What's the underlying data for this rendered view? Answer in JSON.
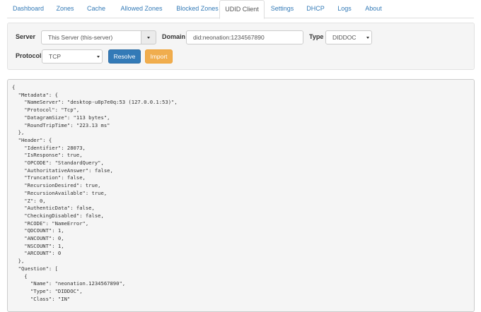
{
  "tabs": [
    {
      "label": "Dashboard"
    },
    {
      "label": "Zones"
    },
    {
      "label": "Cache"
    },
    {
      "label": "Allowed Zones"
    },
    {
      "label": "Blocked Zones"
    },
    {
      "label": "UDID Client"
    },
    {
      "label": "Settings"
    },
    {
      "label": "DHCP"
    },
    {
      "label": "Logs"
    },
    {
      "label": "About"
    }
  ],
  "active_tab": "UDID Client",
  "form": {
    "server_label": "Server",
    "server_value": "This Server (this-server)",
    "domain_label": "Domain",
    "domain_value": "did:neonation:1234567890",
    "type_label": "Type",
    "type_value": "DIDDOC",
    "protocol_label": "Protocol",
    "protocol_value": "TCP",
    "resolve_label": "Resolve",
    "import_label": "Import"
  },
  "colors": {
    "link": "#337ab7",
    "primary": "#337ab7",
    "warning": "#f0ad4e",
    "panel_bg": "#f5f5f5"
  },
  "output_text": "{\n  \"Metadata\": {\n    \"NameServer\": \"desktop-u8p7e0q:53 (127.0.0.1:53)\",\n    \"Protocol\": \"Tcp\",\n    \"DatagramSize\": \"113 bytes\",\n    \"RoundTripTime\": \"223.13 ms\"\n  },\n  \"Header\": {\n    \"Identifier\": 28073,\n    \"IsResponse\": true,\n    \"OPCODE\": \"StandardQuery\",\n    \"AuthoritativeAnswer\": false,\n    \"Truncation\": false,\n    \"RecursionDesired\": true,\n    \"RecursionAvailable\": true,\n    \"Z\": 0,\n    \"AuthenticData\": false,\n    \"CheckingDisabled\": false,\n    \"RCODE\": \"NameError\",\n    \"QDCOUNT\": 1,\n    \"ANCOUNT\": 0,\n    \"NSCOUNT\": 1,\n    \"ARCOUNT\": 0\n  },\n  \"Question\": [\n    {\n      \"Name\": \"neonation.1234567890\",\n      \"Type\": \"DIDDOC\",\n      \"Class\": \"IN\""
}
